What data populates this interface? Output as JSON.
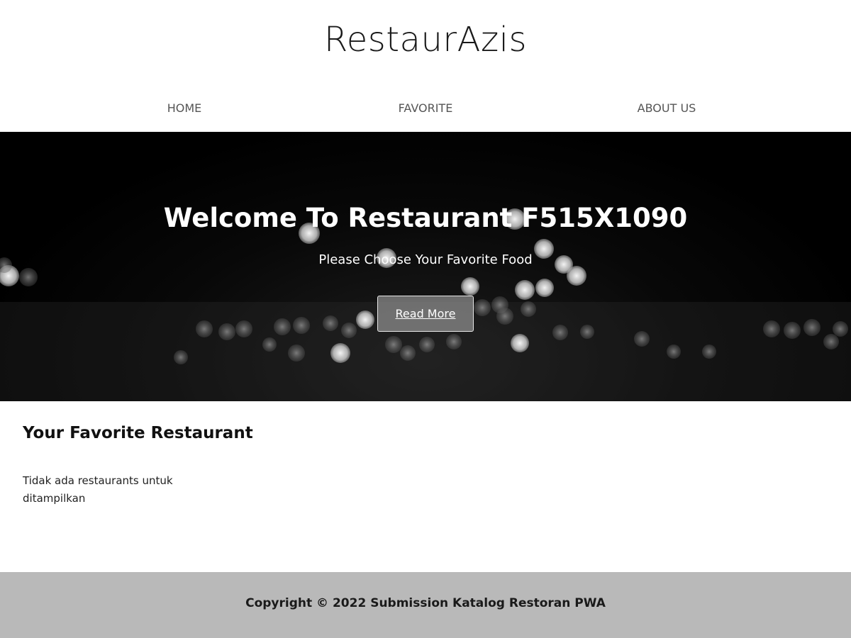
{
  "header": {
    "brand": "RestaurAzis",
    "nav": [
      {
        "label": "HOME"
      },
      {
        "label": "FAVORITE"
      },
      {
        "label": "ABOUT US"
      }
    ]
  },
  "hero": {
    "title": "Welcome To Restaurant F515X1090",
    "subtitle": "Please Choose Your Favorite Food",
    "button_label": "Read More"
  },
  "main": {
    "section_title": "Your Favorite Restaurant",
    "empty_message": "Tidak ada restaurants untuk ditampilkan"
  },
  "footer": {
    "copyright": "Copyright © 2022 Submission Katalog Restoran PWA"
  },
  "colors": {
    "hero_background": "#000000",
    "footer_background": "#b9b9b9",
    "nav_text": "#555555"
  }
}
